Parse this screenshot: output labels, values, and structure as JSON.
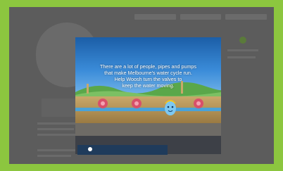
{
  "modal": {
    "intro_line1": "There are a lot of people, pipes and pumps",
    "intro_line2": "that make Melbourne's water cycle run.",
    "intro_line3": "Help Woosh turn the valves to",
    "intro_line4": "keep the water moving."
  },
  "colors": {
    "frame": "#8cc63f",
    "sky": "#1b5ea7",
    "ground": "#c9a86a",
    "pipe": "#4aa2d8",
    "valve": "#d8506a",
    "woosh": "#7ec8f0",
    "helmet": "#f5c518"
  },
  "icons": {
    "valve": "valve-icon",
    "woosh": "woosh-character-icon",
    "progress": "progress-dot-icon"
  }
}
